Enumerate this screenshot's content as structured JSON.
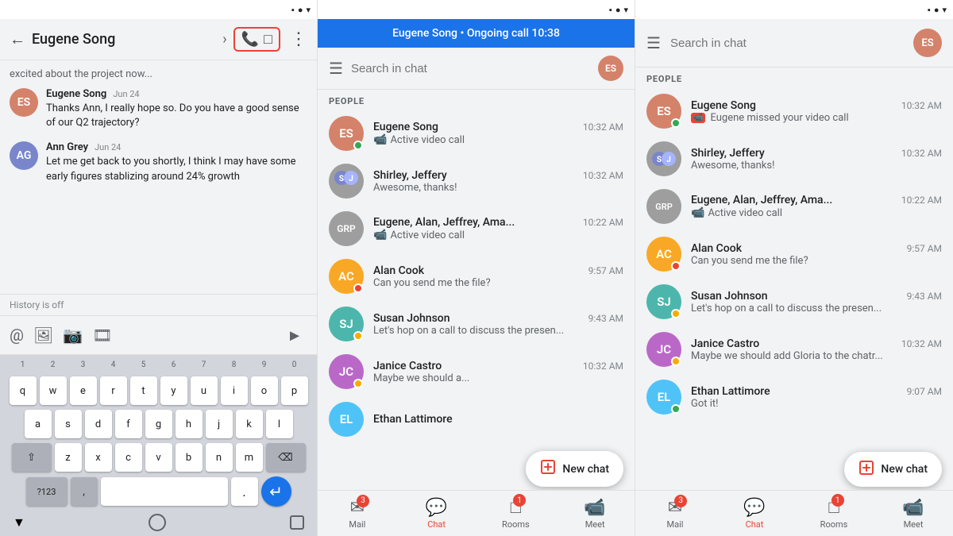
{
  "panel1": {
    "header": {
      "back_label": "←",
      "title": "Eugene Song",
      "chevron": "›",
      "more_label": "⋮",
      "phone_icon": "📞",
      "video_icon": "🎥"
    },
    "messages": [
      {
        "id": "msg1",
        "avatar_color": "av1",
        "avatar_initials": "ES",
        "name": "Eugene Song",
        "time": "Jun 24",
        "text": "Thanks Ann, I really hope so. Do you have a good sense of our Q2 trajectory?"
      },
      {
        "id": "msg2",
        "avatar_color": "av2",
        "avatar_initials": "AG",
        "name": "Ann Grey",
        "time": "Jun 24",
        "text": "Let me get back to you shortly, I think I may have some early figures stablizing around 24% growth"
      }
    ],
    "history_off": "History is off",
    "toolbar_icons": [
      "@",
      "🖼",
      "📷",
      "📹"
    ],
    "keyboard": {
      "row_numbers": [
        "1",
        "2",
        "3",
        "4",
        "5",
        "6",
        "7",
        "8",
        "9",
        "0"
      ],
      "row1": [
        "q",
        "w",
        "e",
        "r",
        "t",
        "y",
        "u",
        "i",
        "o",
        "p"
      ],
      "row2": [
        "a",
        "s",
        "d",
        "f",
        "g",
        "h",
        "j",
        "k",
        "l"
      ],
      "row3": [
        "z",
        "x",
        "c",
        "v",
        "b",
        "n",
        "m"
      ],
      "special_left": "?123",
      "special_comma": ",",
      "special_dot": ".",
      "send": "↵"
    }
  },
  "panel2": {
    "call_banner": "Eugene Song • Ongoing call 10:38",
    "search_placeholder": "Search in chat",
    "section_people": "PEOPLE",
    "chat_items": [
      {
        "name": "Eugene Song",
        "time": "10:32 AM",
        "sub": "Active video call",
        "sub_icon": "📹",
        "avatar_color": "av1",
        "avatar_initials": "ES",
        "status_color": "#34a853"
      },
      {
        "name": "Shirley, Jeffery",
        "time": "10:32 AM",
        "sub": "Awesome, thanks!",
        "sub_icon": "",
        "avatar_color": "av-group",
        "avatar_initials": "SJ",
        "status_color": ""
      },
      {
        "name": "Eugene, Alan, Jeffrey, Ama...",
        "time": "10:22 AM",
        "sub": "Active video call",
        "sub_icon": "📹",
        "avatar_color": "av-group",
        "avatar_initials": "G",
        "status_color": ""
      },
      {
        "name": "Alan Cook",
        "time": "9:57 AM",
        "sub": "Can you send me the file?",
        "sub_icon": "",
        "avatar_color": "av4",
        "avatar_initials": "AC",
        "status_color": "#ea4335"
      },
      {
        "name": "Susan Johnson",
        "time": "9:43 AM",
        "sub": "Let's hop on a call to discuss the presen...",
        "sub_icon": "",
        "avatar_color": "av5",
        "avatar_initials": "SJ",
        "status_color": "#f9ab00"
      },
      {
        "name": "Janice Castro",
        "time": "10:32 AM",
        "sub": "Maybe we should a...",
        "sub_icon": "",
        "avatar_color": "av6",
        "avatar_initials": "JC",
        "status_color": "#f9ab00"
      },
      {
        "name": "Ethan Lattimore",
        "time": "",
        "sub": "",
        "sub_icon": "",
        "avatar_color": "av8",
        "avatar_initials": "EL",
        "status_color": ""
      }
    ],
    "tabs": [
      {
        "label": "Mail",
        "icon": "✉",
        "badge": "3",
        "active": false
      },
      {
        "label": "Chat",
        "icon": "💬",
        "badge": "",
        "active": true
      },
      {
        "label": "Rooms",
        "icon": "⊞",
        "badge": "1",
        "active": false
      },
      {
        "label": "Meet",
        "icon": "📹",
        "badge": "",
        "active": false
      }
    ],
    "new_chat_label": "New chat"
  },
  "panel3": {
    "search_placeholder": "Search in chat",
    "section_people": "PEOPLE",
    "chat_items": [
      {
        "name": "Eugene Song",
        "time": "10:32 AM",
        "sub": "Eugene missed your video call",
        "sub_type": "missed",
        "avatar_color": "av1",
        "avatar_initials": "ES",
        "status_color": "#34a853"
      },
      {
        "name": "Shirley, Jeffery",
        "time": "10:32 AM",
        "sub": "Awesome, thanks!",
        "sub_type": "",
        "avatar_color": "av-group",
        "avatar_initials": "SJ",
        "status_color": ""
      },
      {
        "name": "Eugene, Alan, Jeffrey, Ama...",
        "time": "10:22 AM",
        "sub": "Active video call",
        "sub_type": "video",
        "avatar_color": "av-group",
        "avatar_initials": "G",
        "status_color": ""
      },
      {
        "name": "Alan Cook",
        "time": "9:57 AM",
        "sub": "Can you send me the file?",
        "sub_type": "",
        "avatar_color": "av4",
        "avatar_initials": "AC",
        "status_color": "#ea4335"
      },
      {
        "name": "Susan Johnson",
        "time": "9:43 AM",
        "sub": "Let's hop on a call to discuss the presen...",
        "sub_type": "",
        "avatar_color": "av5",
        "avatar_initials": "SJ",
        "status_color": "#f9ab00"
      },
      {
        "name": "Janice Castro",
        "time": "10:32 AM",
        "sub": "Maybe we should add Gloria to the chatr...",
        "sub_type": "",
        "avatar_color": "av6",
        "avatar_initials": "JC",
        "status_color": "#f9ab00"
      },
      {
        "name": "Ethan Lattimore",
        "time": "9:07 AM",
        "sub": "Got it!",
        "sub_type": "",
        "avatar_color": "av8",
        "avatar_initials": "EL",
        "status_color": "#34a853"
      }
    ],
    "tabs": [
      {
        "label": "Mail",
        "icon": "✉",
        "badge": "3",
        "active": false
      },
      {
        "label": "Chat",
        "icon": "💬",
        "badge": "",
        "active": true
      },
      {
        "label": "Rooms",
        "icon": "⊞",
        "badge": "1",
        "active": false
      },
      {
        "label": "Meet",
        "icon": "📹",
        "badge": "",
        "active": false
      }
    ],
    "new_chat_label": "New chat"
  },
  "status_bar": {
    "shapes": [
      "▪",
      "●",
      "▾"
    ]
  }
}
